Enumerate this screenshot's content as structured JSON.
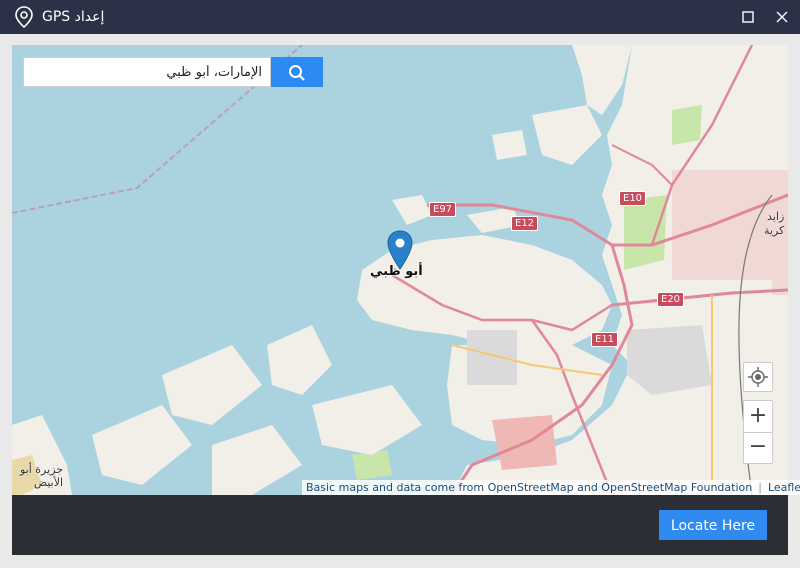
{
  "window": {
    "title": "إعداد GPS",
    "icons": {
      "title": "location-pin-icon",
      "maximize": "maximize-icon",
      "close": "close-icon"
    }
  },
  "search": {
    "value": "الإمارات، أبو ظبي",
    "button_icon": "search-icon"
  },
  "map": {
    "labels": {
      "city": "أبو ظبي",
      "island_line1": "جزيرة أبو",
      "island_line2": "الأبيض",
      "east_line1": "زايد",
      "east_line2": "كرية"
    },
    "road_shields": [
      "E97",
      "E12",
      "E10",
      "E20",
      "E11"
    ],
    "controls": {
      "locate_icon": "crosshair-icon",
      "zoom_in": "+",
      "zoom_out": "−"
    },
    "attribution": {
      "text": "Basic maps and data come from OpenStreetMap and OpenStreetMap Foundation",
      "link": "Leaflet"
    }
  },
  "footer": {
    "locate_button": "Locate Here"
  },
  "colors": {
    "titlebar": "#2c3148",
    "water": "#aad3df",
    "land": "#f2efe9",
    "accent": "#2b8bf2",
    "marker": "#2a81cb",
    "bottom_bar": "#2c2e36"
  }
}
